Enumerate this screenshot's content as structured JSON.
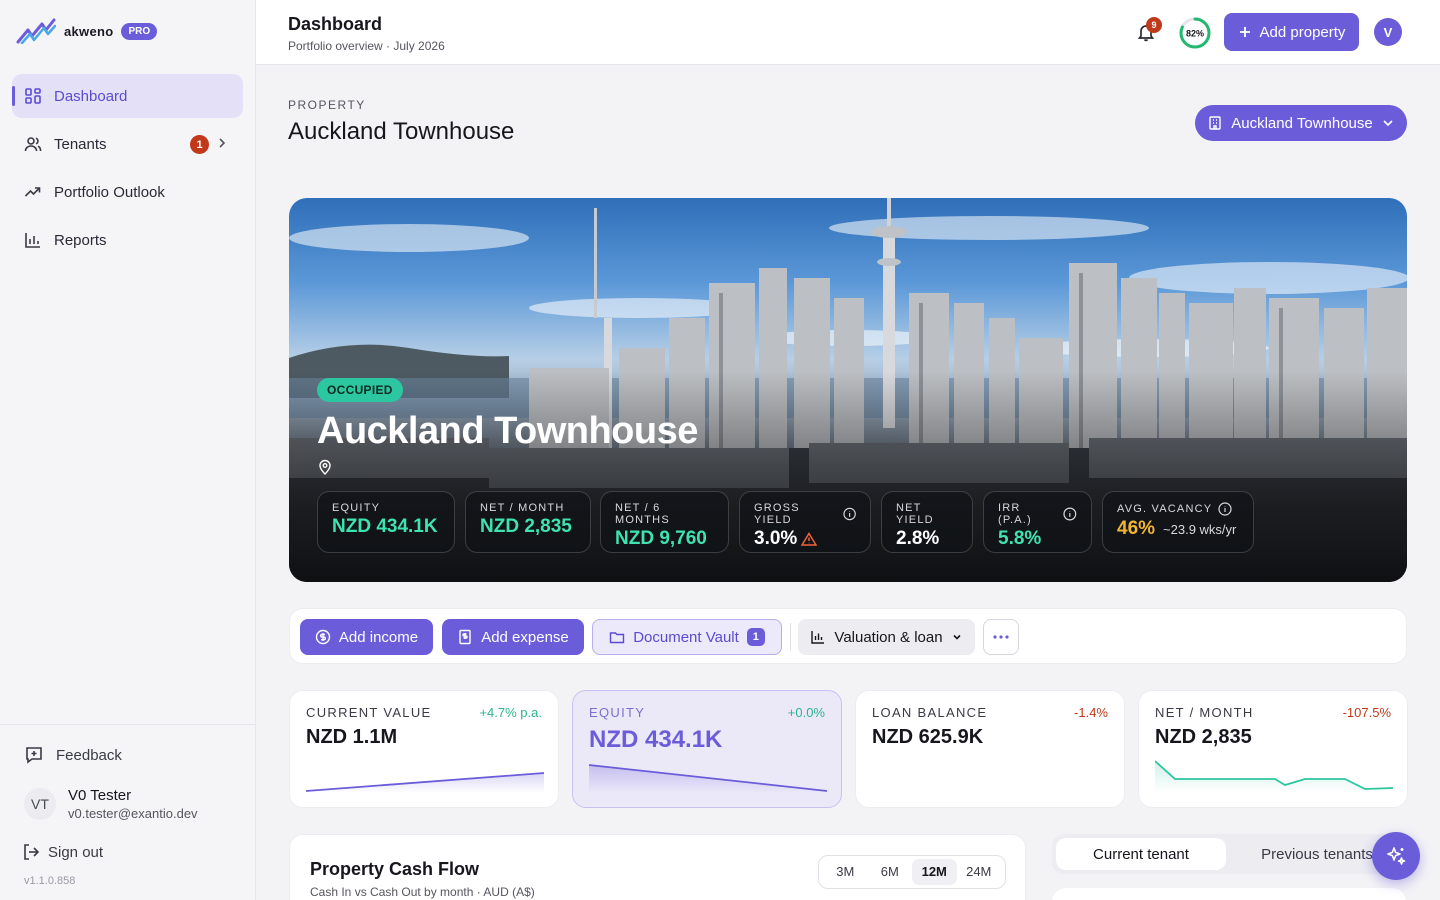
{
  "brand": {
    "name": "akweno",
    "plan_badge": "PRO"
  },
  "sidebar": {
    "items": [
      {
        "label": "Dashboard",
        "icon": "grid-icon",
        "active": true
      },
      {
        "label": "Tenants",
        "icon": "users-icon",
        "badge": "1"
      },
      {
        "label": "Portfolio Outlook",
        "icon": "trend-icon"
      },
      {
        "label": "Reports",
        "icon": "bar-chart-icon"
      }
    ],
    "feedback_label": "Feedback",
    "user": {
      "initials": "VT",
      "name": "V0 Tester",
      "email": "v0.tester@exantio.dev"
    },
    "signout_label": "Sign out",
    "version": "v1.1.0.858"
  },
  "header": {
    "title": "Dashboard",
    "subtitle": "Portfolio overview · July 2026",
    "notifications": "9",
    "completion": "82%",
    "completion_value": 0.82,
    "add_property_label": "Add property",
    "avatar_initial": "V"
  },
  "property": {
    "section_label": "PROPERTY",
    "title": "Auckland Townhouse",
    "selector_label": "Auckland Townhouse"
  },
  "hero": {
    "status": "OCCUPIED",
    "name": "Auckland Townhouse",
    "stats": [
      {
        "label": "EQUITY",
        "value": "NZD 434.1K"
      },
      {
        "label": "NET / MONTH",
        "value": "NZD 2,835"
      },
      {
        "label": "NET / 6 MONTHS",
        "value": "NZD 9,760"
      },
      {
        "label": "GROSS YIELD",
        "value": "3.0%"
      },
      {
        "label": "NET YIELD",
        "value": "2.8%"
      },
      {
        "label": "IRR (P.A.)",
        "value": "5.8%"
      },
      {
        "label": "AVG. VACANCY",
        "value": "46%",
        "sub": "~23.9 wks/yr"
      }
    ]
  },
  "actions": {
    "add_income": "Add income",
    "add_expense": "Add expense",
    "document_vault": "Document Vault",
    "document_count": "1",
    "valuation_loan": "Valuation & loan",
    "more": "···"
  },
  "cards": [
    {
      "label": "CURRENT VALUE",
      "delta": "+4.7% p.a.",
      "value": "NZD 1.1M",
      "delta_color": "#2cb58f"
    },
    {
      "label": "EQUITY",
      "delta": "+0.0%",
      "value": "NZD 434.1K",
      "delta_color": "#2cb58f"
    },
    {
      "label": "LOAN BALANCE",
      "delta": "-1.4%",
      "value": "NZD 625.9K",
      "delta_color": "#c0391b"
    },
    {
      "label": "NET / MONTH",
      "delta": "-107.5%",
      "value": "NZD 2,835",
      "delta_color": "#c0391b"
    }
  ],
  "cashflow": {
    "title": "Property Cash Flow",
    "subtitle": "Cash In vs Cash Out by month · AUD (A$)",
    "ranges": [
      "3M",
      "6M",
      "12M",
      "24M"
    ],
    "selected_range": "12M"
  },
  "tenant_tabs": {
    "current": "Current tenant",
    "previous": "Previous tenants"
  },
  "colors": {
    "accent": "#6b5cd9",
    "success": "#2cc6a0",
    "danger": "#c0391b",
    "warning": "#f2b532"
  }
}
